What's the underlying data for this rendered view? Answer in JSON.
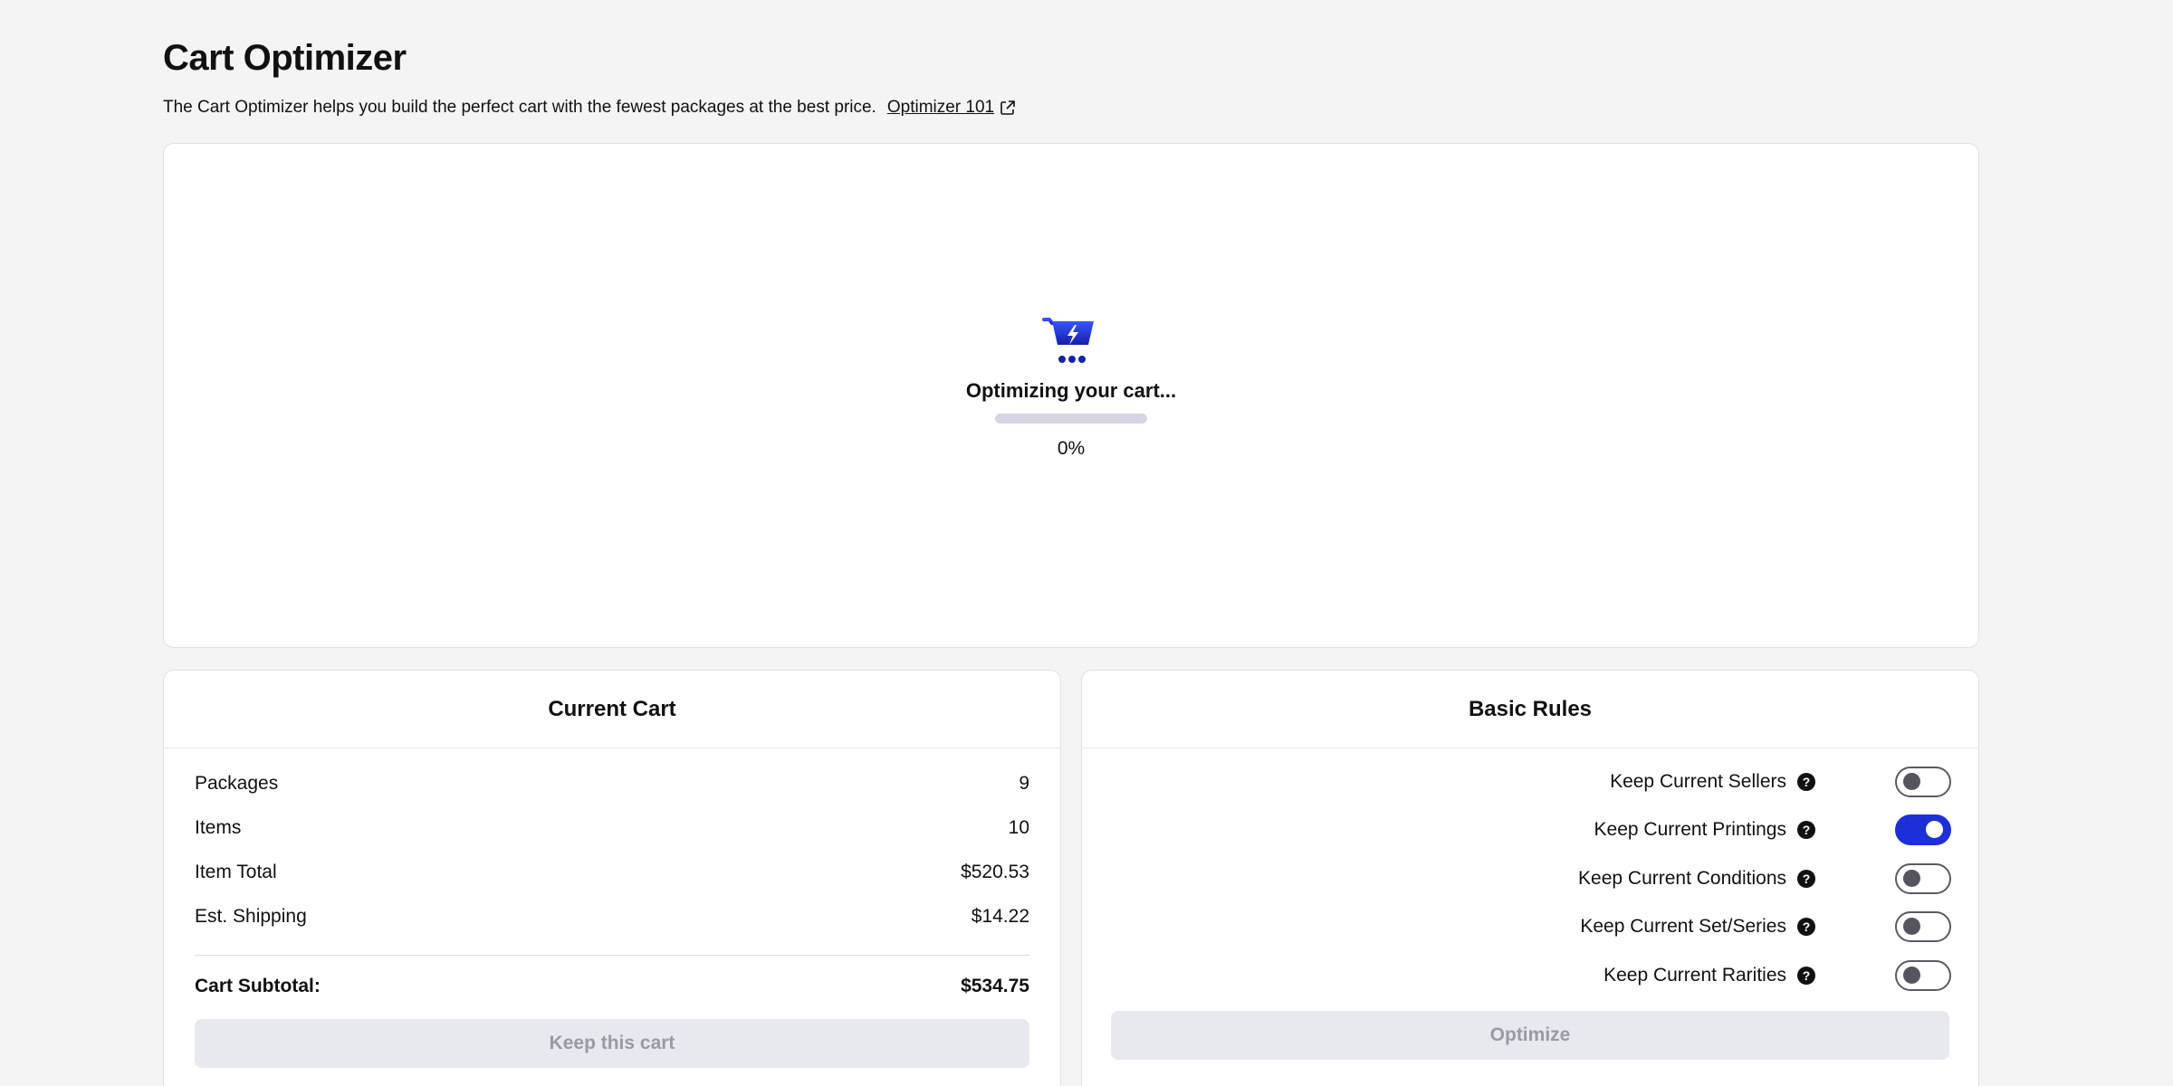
{
  "header": {
    "title": "Cart Optimizer",
    "description": "The Cart Optimizer helps you build the perfect cart with the fewest packages at the best price.",
    "link_label": "Optimizer 101"
  },
  "status": {
    "icon": "cart-lightning-icon",
    "message": "Optimizing your cart...",
    "progress": 0,
    "progress_label": "0%"
  },
  "current_cart": {
    "title": "Current Cart",
    "rows": [
      {
        "label": "Packages",
        "value": "9"
      },
      {
        "label": "Items",
        "value": "10"
      },
      {
        "label": "Item Total",
        "value": "$520.53"
      },
      {
        "label": "Est. Shipping",
        "value": "$14.22"
      }
    ],
    "subtotal_label": "Cart Subtotal:",
    "subtotal_value": "$534.75",
    "button_label": "Keep this cart"
  },
  "basic_rules": {
    "title": "Basic Rules",
    "rules": [
      {
        "label": "Keep Current Sellers",
        "on": false
      },
      {
        "label": "Keep Current Printings",
        "on": true
      },
      {
        "label": "Keep Current Conditions",
        "on": false
      },
      {
        "label": "Keep Current Set/Series",
        "on": false
      },
      {
        "label": "Keep Current Rarities",
        "on": false
      }
    ],
    "button_label": "Optimize"
  },
  "colors": {
    "accent": "#1d2fd8",
    "background": "#f4f4f4",
    "disabled_button": "#e8e8ef"
  }
}
